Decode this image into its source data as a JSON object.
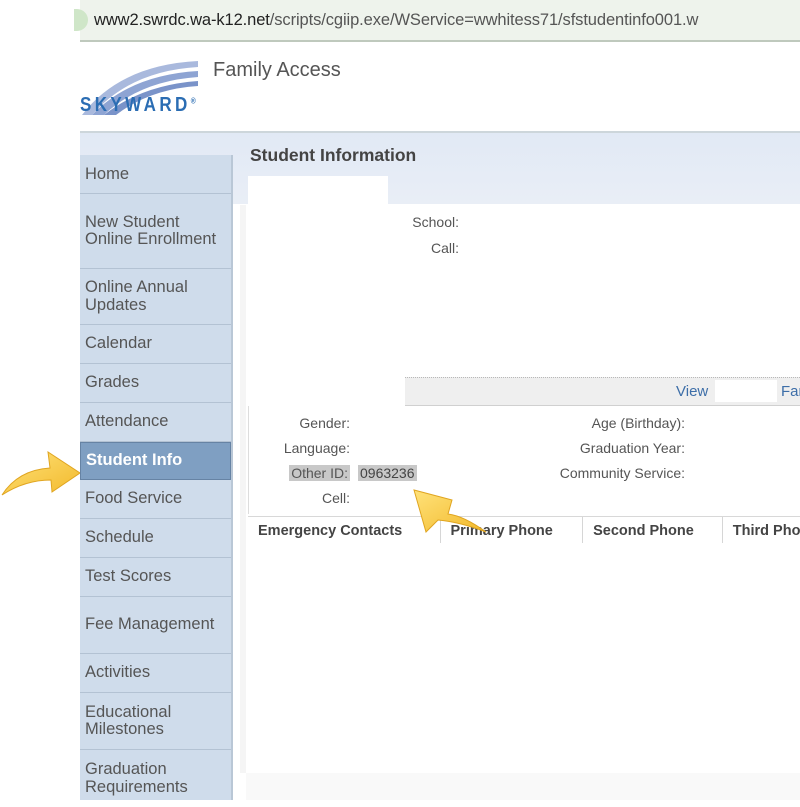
{
  "browser": {
    "url_host": "www2.swrdc.wa-k12.net",
    "url_path": "/scripts/cgiip.exe/WService=wwhitess71/sfstudentinfo001.w"
  },
  "header": {
    "logo_text": "SKYWARD",
    "app_title": "Family Access"
  },
  "colors": {
    "brand_blue": "#2b6db3",
    "nav_background": "#cfdceb",
    "nav_active": "#7f9fc2",
    "link_blue": "#3d6ea8",
    "highlight": "#c8c8c8",
    "arrow_yellow": "#f7cf4a"
  },
  "sidebar": {
    "items": [
      {
        "label": "Home"
      },
      {
        "label": "New Student Online Enrollment"
      },
      {
        "label": "Online Annual Updates"
      },
      {
        "label": "Calendar"
      },
      {
        "label": "Grades"
      },
      {
        "label": "Attendance"
      },
      {
        "label": "Student Info",
        "active": true
      },
      {
        "label": "Food Service"
      },
      {
        "label": "Schedule"
      },
      {
        "label": "Test Scores"
      },
      {
        "label": "Fee Management"
      },
      {
        "label": "Activities"
      },
      {
        "label": "Educational Milestones"
      },
      {
        "label": "Graduation Requirements"
      }
    ]
  },
  "main": {
    "page_title": "Student Information",
    "top_fields": {
      "school_label": "School:",
      "call_label": "Call:"
    },
    "view_bar": {
      "view_link": "View",
      "family_link_partial": "Fan"
    },
    "left_fields": {
      "gender_label": "Gender:",
      "language_label": "Language:",
      "other_id_label": "Other ID:",
      "other_id_value": "0963236",
      "cell_label": "Cell:"
    },
    "right_fields": {
      "age_label": "Age (Birthday):",
      "grad_year_label": "Graduation Year:",
      "community_service_label": "Community Service:"
    },
    "emergency_table": {
      "columns": [
        "Emergency Contacts",
        "Primary Phone",
        "Second Phone",
        "Third Phone"
      ]
    }
  },
  "annotations": {
    "arrow_1": "pointer-arrow-to-student-info",
    "arrow_2": "pointer-arrow-to-other-id"
  }
}
